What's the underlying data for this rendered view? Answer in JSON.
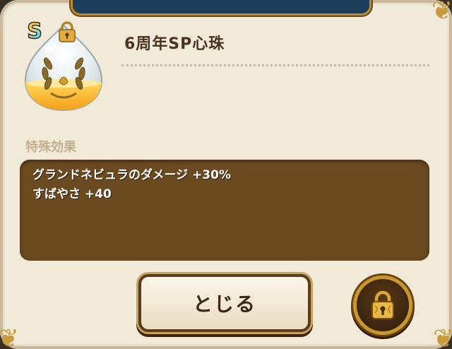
{
  "item": {
    "rank": "S",
    "name": "6周年SP心珠"
  },
  "effects": {
    "section_label": "特殊効果",
    "lines": [
      "グランドネビュラのダメージ +30%",
      "すばやさ +40"
    ]
  },
  "buttons": {
    "close_label": "とじる"
  },
  "icons": {
    "rank_badge": "rainbow-s-badge",
    "lock_small": "lock-icon",
    "lock_button": "lock-icon",
    "orb": "heart-orb-laurel"
  },
  "colors": {
    "panel": "#f1ead9",
    "effect_box": "#6b4a20",
    "header_navy": "#1e3d5a",
    "gold_trim": "#c8962e"
  }
}
